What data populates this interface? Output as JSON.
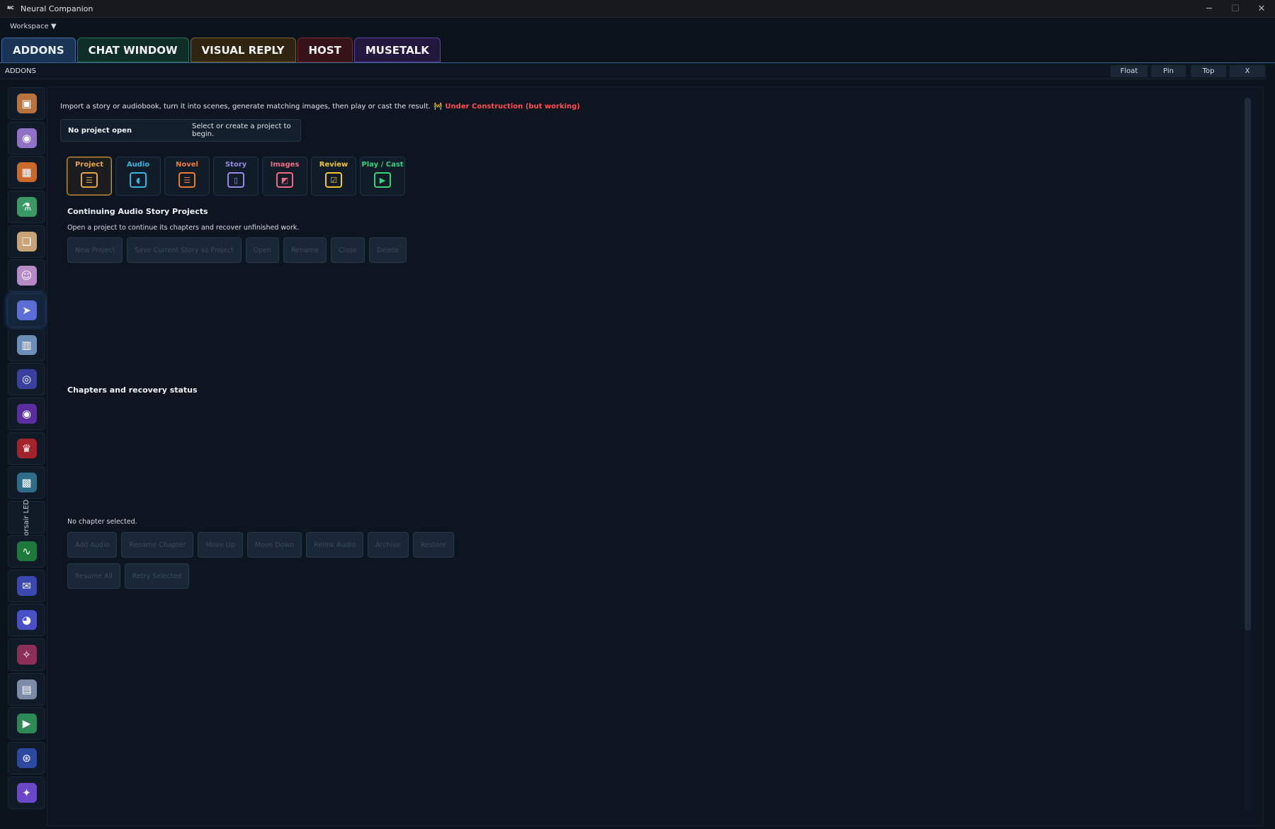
{
  "window": {
    "app_icon_text": "NC",
    "title": "Neural Companion",
    "minimize_glyph": "─",
    "maximize_glyph": "☐",
    "close_glyph": "✕"
  },
  "menubar": {
    "workspace": "Workspace ▼"
  },
  "tabs": [
    {
      "label": "ADDONS",
      "active": true
    },
    {
      "label": "CHAT WINDOW"
    },
    {
      "label": "VISUAL REPLY"
    },
    {
      "label": "HOST"
    },
    {
      "label": "MUSETALK"
    }
  ],
  "header": {
    "label": "ADDONS",
    "float": "Float",
    "pin": "Pin",
    "top": "Top",
    "close": "X"
  },
  "sidebar": {
    "items": [
      {
        "icon": "storyboard-icon",
        "glyph": "▣",
        "color": "#b8743c"
      },
      {
        "icon": "brain-icon",
        "glyph": "◉",
        "color": "#8f72c8"
      },
      {
        "icon": "grid-app-icon",
        "glyph": "▦",
        "color": "#c96a2a"
      },
      {
        "icon": "lab-flask-icon",
        "glyph": "⚗",
        "color": "#3a9a66"
      },
      {
        "icon": "open-book-icon",
        "glyph": "❑",
        "color": "#c9a276"
      },
      {
        "icon": "face-icon",
        "glyph": "☺",
        "color": "#b58ac5"
      },
      {
        "icon": "avatar-cursor-icon",
        "glyph": "➤",
        "color": "#5b6ed8"
      },
      {
        "icon": "dashboard-icon",
        "glyph": "▥",
        "color": "#6b8fb8"
      },
      {
        "icon": "target-icon",
        "glyph": "◎",
        "color": "#3a3fa0"
      },
      {
        "icon": "orbit-icon",
        "glyph": "◉",
        "color": "#5a2ea0"
      },
      {
        "icon": "red-mask-icon",
        "glyph": "♛",
        "color": "#a2232c"
      },
      {
        "icon": "landscape-image-icon",
        "glyph": "▩",
        "color": "#2e6c8a"
      },
      {
        "icon": "waveform-icon",
        "glyph": "∿",
        "color": "#1e7a3c"
      },
      {
        "icon": "chat-bubbles-icon",
        "glyph": "✉",
        "color": "#3a48b0"
      },
      {
        "icon": "discord-icon",
        "glyph": "◕",
        "color": "#4a4fc8"
      },
      {
        "icon": "pink-noise-icon",
        "glyph": "✧",
        "color": "#8c2f58"
      },
      {
        "icon": "keyboard-icon",
        "glyph": "▤",
        "color": "#7c8aa8"
      },
      {
        "icon": "play-circle-icon",
        "glyph": "▶",
        "color": "#2e8a54"
      },
      {
        "icon": "robot-head-icon",
        "glyph": "⊛",
        "color": "#2e4aa0"
      },
      {
        "icon": "magic-sparkle-icon",
        "glyph": "✦",
        "color": "#6a48c8"
      }
    ],
    "vertical_label": "orsair LED"
  },
  "intro": {
    "text": "Import a story or audiobook, turn it into scenes, generate matching images, then play or cast the result.",
    "warn_glyph": "🚧",
    "warning": "Under Construction (but working)"
  },
  "project_box": {
    "title": "No project open",
    "hint": "Select or create a project to begin."
  },
  "steps": [
    {
      "label": "Project",
      "icon": "project-icon",
      "glyph": "☰",
      "color": "#e8a640",
      "selected": true
    },
    {
      "label": "Audio",
      "icon": "speaker-icon",
      "glyph": "◖",
      "color": "#3ab4e0"
    },
    {
      "label": "Novel",
      "icon": "novel-icon",
      "glyph": "☰",
      "color": "#ef7a34"
    },
    {
      "label": "Story",
      "icon": "book-icon",
      "glyph": "▯",
      "color": "#9a8ae8"
    },
    {
      "label": "Images",
      "icon": "image-icon",
      "glyph": "◩",
      "color": "#f06c86"
    },
    {
      "label": "Review",
      "icon": "checklist-icon",
      "glyph": "☑",
      "color": "#f4c431"
    },
    {
      "label": "Play / Cast",
      "icon": "play-icon",
      "glyph": "▶",
      "color": "#3ad07a"
    }
  ],
  "continuing": {
    "title": "Continuing Audio Story Projects",
    "subtitle": "Open a project to continue its chapters and recover unfinished work.",
    "buttons": [
      "New Project",
      "Save Current Story as Project",
      "Open",
      "Rename",
      "Close",
      "Delete"
    ]
  },
  "chapters": {
    "title": "Chapters and recovery status",
    "status": "No chapter selected.",
    "buttons_row1": [
      "Add Audio",
      "Rename Chapter",
      "Move Up",
      "Move Down",
      "Relink Audio",
      "Archive",
      "Restore"
    ],
    "buttons_row2": [
      "Resume All",
      "Retry Selected"
    ]
  }
}
